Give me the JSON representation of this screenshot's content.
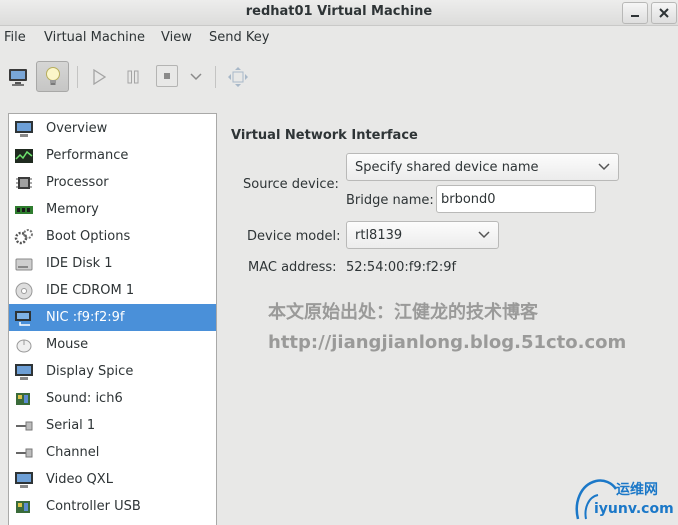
{
  "window": {
    "title": "redhat01 Virtual Machine"
  },
  "menu": [
    "File",
    "Virtual Machine",
    "View",
    "Send Key"
  ],
  "sidebar": {
    "items": [
      {
        "label": "Overview",
        "icon": "monitor-icon"
      },
      {
        "label": "Performance",
        "icon": "performance-graph-icon"
      },
      {
        "label": "Processor",
        "icon": "cpu-chip-icon"
      },
      {
        "label": "Memory",
        "icon": "memory-module-icon"
      },
      {
        "label": "Boot Options",
        "icon": "gears-icon"
      },
      {
        "label": "IDE Disk 1",
        "icon": "hard-disk-icon"
      },
      {
        "label": "IDE CDROM 1",
        "icon": "cdrom-icon"
      },
      {
        "label": "NIC :f9:f2:9f",
        "icon": "network-card-icon",
        "selected": true
      },
      {
        "label": "Mouse",
        "icon": "mouse-icon"
      },
      {
        "label": "Display Spice",
        "icon": "display-icon"
      },
      {
        "label": "Sound: ich6",
        "icon": "sound-card-icon"
      },
      {
        "label": "Serial 1",
        "icon": "serial-port-icon"
      },
      {
        "label": "Channel",
        "icon": "channel-icon"
      },
      {
        "label": "Video QXL",
        "icon": "video-display-icon"
      },
      {
        "label": "Controller USB",
        "icon": "controller-card-icon"
      }
    ]
  },
  "details": {
    "heading": "Virtual Network Interface",
    "source_device_label": "Source device:",
    "source_device_value": "Specify shared device name",
    "bridge_name_label": "Bridge name:",
    "bridge_name_value": "brbond0",
    "device_model_label": "Device model:",
    "device_model_value": "rtl8139",
    "mac_label": "MAC address:",
    "mac_value": "52:54:00:f9:f2:9f"
  },
  "watermark": {
    "line1": "本文原始出处：江健龙的技术博客",
    "line2": "http://jiangjianlong.blog.51cto.com",
    "logo_cn": "运维网",
    "logo_url": "iyunv.com"
  },
  "colors": {
    "selection": "#4a90d9",
    "background": "#e8e8e7",
    "watermark": "#9a9a99",
    "logo_blue": "#1b78c8"
  }
}
